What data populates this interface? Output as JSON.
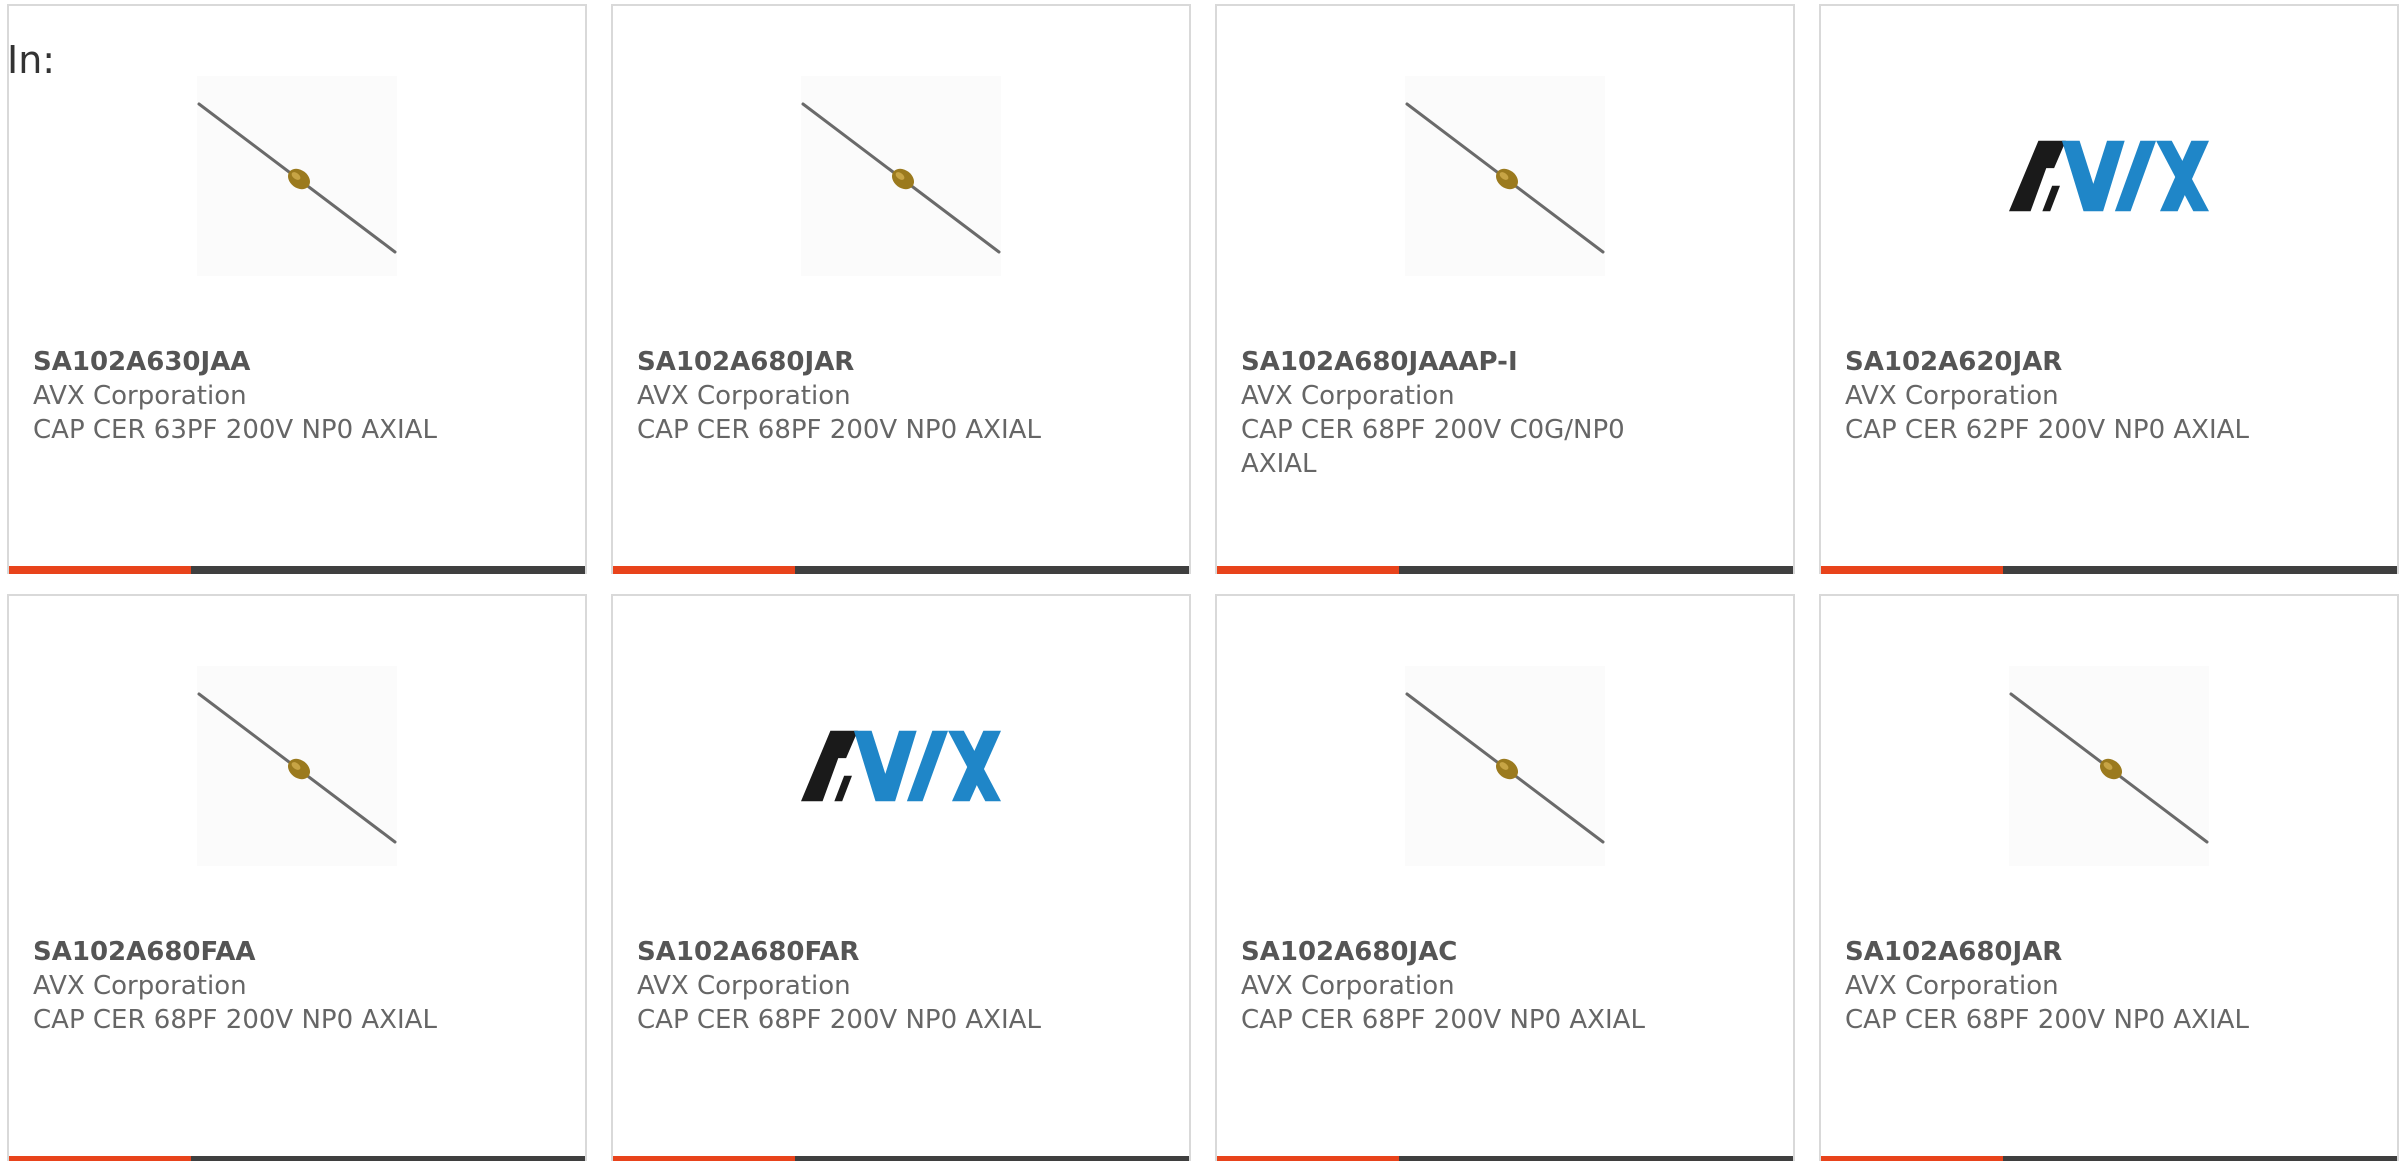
{
  "header": {
    "in_label": "In:"
  },
  "colors": {
    "accent": "#e8431b",
    "bar": "#3f3f3f",
    "avx_black": "#1a1a1a",
    "avx_blue": "#1f86c8"
  },
  "products": [
    {
      "part_number": "SA102A630JAA",
      "manufacturer": "AVX Corporation",
      "description": "CAP CER 63PF 200V NP0 AXIAL",
      "image": "axial-capacitor-icon"
    },
    {
      "part_number": "SA102A680JAR",
      "manufacturer": "AVX Corporation",
      "description": "CAP CER 68PF 200V NP0 AXIAL",
      "image": "axial-capacitor-icon"
    },
    {
      "part_number": "SA102A680JAAAP-I",
      "manufacturer": "AVX Corporation",
      "description": "CAP CER 68PF 200V C0G/NP0 AXIAL",
      "image": "axial-capacitor-icon"
    },
    {
      "part_number": "SA102A620JAR",
      "manufacturer": "AVX Corporation",
      "description": "CAP CER 62PF 200V NP0 AXIAL",
      "image": "avx-logo"
    },
    {
      "part_number": "SA102A680FAA",
      "manufacturer": "AVX Corporation",
      "description": "CAP CER 68PF 200V NP0 AXIAL",
      "image": "axial-capacitor-icon"
    },
    {
      "part_number": "SA102A680FAR",
      "manufacturer": "AVX Corporation",
      "description": "CAP CER 68PF 200V NP0 AXIAL",
      "image": "avx-logo"
    },
    {
      "part_number": "SA102A680JAC",
      "manufacturer": "AVX Corporation",
      "description": "CAP CER 68PF 200V NP0 AXIAL",
      "image": "axial-capacitor-icon"
    },
    {
      "part_number": "SA102A680JAR",
      "manufacturer": "AVX Corporation",
      "description": "CAP CER 68PF 200V NP0 AXIAL",
      "image": "axial-capacitor-icon"
    }
  ]
}
